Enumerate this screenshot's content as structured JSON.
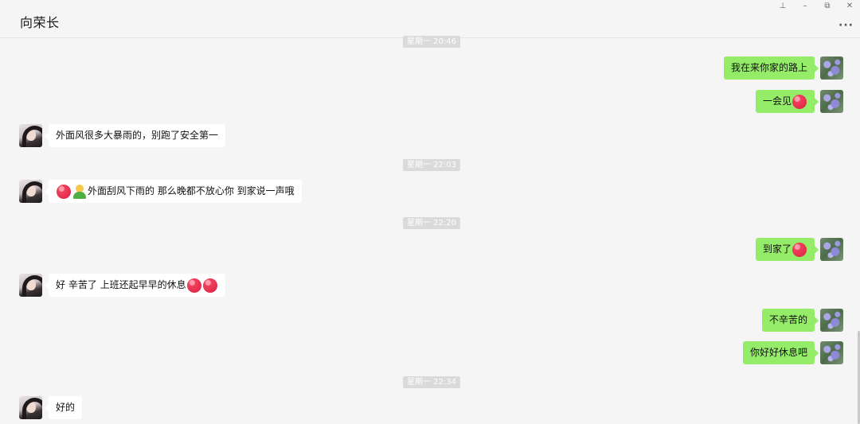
{
  "header": {
    "title": "向荣长",
    "more_icon": "more-dots-icon",
    "window_controls": [
      "pin-icon",
      "minimize-icon",
      "restore-icon",
      "close-icon"
    ],
    "glyphs": {
      "pin": "⊥",
      "minimize": "–",
      "restore": "⧉",
      "close": "✕",
      "more": "···"
    }
  },
  "colors": {
    "background": "#f5f5f5",
    "bubble_out": "#95ec69",
    "bubble_in": "#ffffff",
    "timestamp_bg": "#dadada"
  },
  "timestamps": [
    "星期一 20:46",
    "星期一 22:03",
    "星期一 22:20",
    "星期一 22:34"
  ],
  "messages": [
    {
      "sender": "self",
      "text": "我在来你家的路上"
    },
    {
      "sender": "self",
      "text": "一会见",
      "emoji_after": [
        "heart-emoji"
      ]
    },
    {
      "sender": "contact",
      "text": "外面风很多大暴雨的，别跑了安全第一"
    },
    {
      "sender": "contact",
      "text": "外面刮风下雨的 那么晚都不放心你 到家说一声哦",
      "emoji_before": [
        "heart-emoji",
        "person-emoji"
      ]
    },
    {
      "sender": "self",
      "text": "到家了",
      "emoji_after": [
        "heart-emoji"
      ]
    },
    {
      "sender": "contact",
      "text": "好 辛苦了 上班还起早早的休息",
      "emoji_after": [
        "heart-emoji",
        "heart-emoji"
      ]
    },
    {
      "sender": "self",
      "text": "不辛苦的"
    },
    {
      "sender": "self",
      "text": "你好好休息吧"
    },
    {
      "sender": "contact",
      "text": "好的"
    }
  ]
}
